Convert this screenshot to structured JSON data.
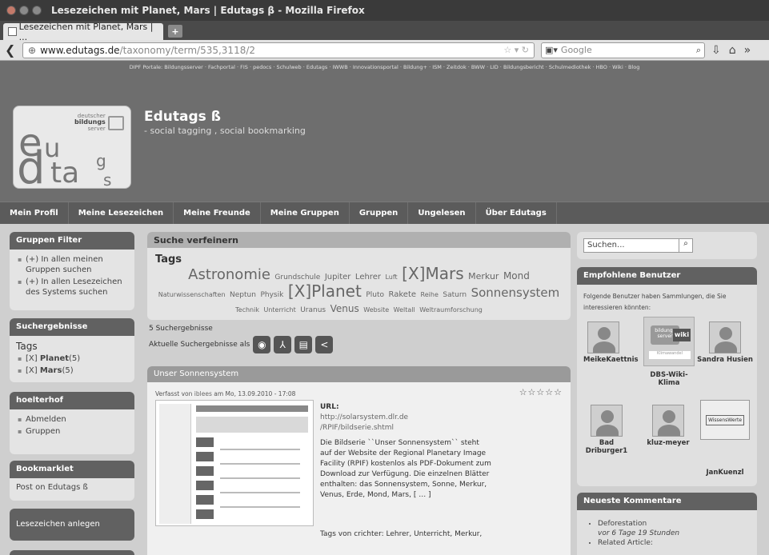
{
  "window": {
    "title": "Lesezeichen mit Planet, Mars | Edutags β - Mozilla Firefox"
  },
  "tab": {
    "label": "Lesezeichen mit Planet, Mars | ...",
    "new_tab": "+"
  },
  "nav": {
    "url_domain": "www.edutags.de",
    "url_path": "/taxonomy/term/535,3118/2",
    "search_placeholder": "Google"
  },
  "portal_links": "DIPF Portale: Bildungsserver · Fachportal · FIS · pedocs · Schulweb · Edutags · IWWB · Innovationsportal · Bildung+ · ISM · Zeitdok · BWW · LID · Bildungsbericht · Schulmediothek · HBO · Wiki · Blog",
  "logo": {
    "small1": "deutscher",
    "small2": "bildungs",
    "small3": "server",
    "e": "e",
    "u": "u",
    "d": "d",
    "ta": "ta",
    "g": "g",
    "s": "s"
  },
  "site": {
    "title": "Edutags ß",
    "subtitle": "- social tagging , social bookmarking"
  },
  "menu": [
    "Mein Profil",
    "Meine Lesezeichen",
    "Meine Freunde",
    "Meine Gruppen",
    "Gruppen",
    "Ungelesen",
    "Über Edutags"
  ],
  "left": {
    "gruppen_filter": {
      "title": "Gruppen Filter",
      "items": [
        "(+) In allen meinen Gruppen suchen",
        "(+) In allen Lesezeichen des Systems suchen"
      ]
    },
    "suchergebnisse": {
      "title": "Suchergebnisse",
      "tags_label": "Tags",
      "items": [
        {
          "prefix": "[X]",
          "tag": "Planet",
          "count": "(5)"
        },
        {
          "prefix": "[X]",
          "tag": "Mars",
          "count": "(5)"
        }
      ]
    },
    "user": {
      "title": "hoelterhof",
      "items": [
        "Abmelden",
        "Gruppen"
      ]
    },
    "bookmarklet": {
      "title": "Bookmarklet",
      "body": "Post on Edutags ß"
    },
    "lesezeichen": {
      "body": "Lesezeichen anlegen"
    }
  },
  "middle": {
    "refine_title": "Suche verfeinern",
    "tags_title": "Tags",
    "tags": [
      {
        "t": "Astronomie",
        "s": "18px"
      },
      {
        "t": "Grundschule",
        "s": "9px"
      },
      {
        "t": "Jupiter",
        "s": "10px"
      },
      {
        "t": "Lehrer",
        "s": "10px"
      },
      {
        "t": "Luft",
        "s": "8px"
      },
      {
        "t": "[X]Mars",
        "s": "20px"
      },
      {
        "t": "Merkur",
        "s": "11px"
      },
      {
        "t": "Mond",
        "s": "12px"
      },
      {
        "t": "Naturwissenschaften",
        "s": "8px"
      },
      {
        "t": "Neptun",
        "s": "9px"
      },
      {
        "t": "Physik",
        "s": "9px"
      },
      {
        "t": "[X]Planet",
        "s": "20px"
      },
      {
        "t": "Pluto",
        "s": "9px"
      },
      {
        "t": "Rakete",
        "s": "10px"
      },
      {
        "t": "Reihe",
        "s": "8px"
      },
      {
        "t": "Saturn",
        "s": "9px"
      },
      {
        "t": "Sonnensystem",
        "s": "15px"
      },
      {
        "t": "Technik",
        "s": "8px"
      },
      {
        "t": "Unterricht",
        "s": "8px"
      },
      {
        "t": "Uranus",
        "s": "9px"
      },
      {
        "t": "Venus",
        "s": "12px"
      },
      {
        "t": "Website",
        "s": "8px"
      },
      {
        "t": "Weltall",
        "s": "8px"
      },
      {
        "t": "Weltraumforschung",
        "s": "8px"
      }
    ],
    "result_count": "5 Suchergebnisse",
    "export_label": "Aktuelle Suchergebnisse als",
    "article": {
      "title": "Unser Sonnensystem",
      "meta_prefix": "Verfasst von",
      "meta_author": "iblees",
      "meta_date": "am Mo, 13.09.2010 - 17:08",
      "stars": "☆☆☆☆☆",
      "url_label": "URL:",
      "url1": "http://solarsystem.dlr.de",
      "url2": "/RPIF/bildserie.shtml",
      "desc": "Die Bildserie ``Unser Sonnensystem`` steht auf der Website der Regional Planetary Image Facility (RPIF) kostenlos als PDF-Dokument zum Download zur Verfügung. Die einzelnen Blätter enthalten: das Sonnensystem, Sonne, Merkur, Venus, Erde, Mond, Mars, [ … ]",
      "tags_prefix": "Tags von",
      "tags_author": "crichter",
      "tags_list": ": Lehrer, Unterricht, Merkur,"
    }
  },
  "right": {
    "search_placeholder": "Suchen...",
    "empf_title": "Empfohlene Benutzer",
    "empf_intro": "Folgende Benutzer haben Sammlungen, die Sie interessieren könnten:",
    "users": [
      "MeikeKaettnis",
      "DBS-Wiki-Klima",
      "Sandra Husien",
      "Bad Driburger1",
      "kluz-meyer",
      "JanKuenzl"
    ],
    "wiki_badge": "wiki",
    "wiki_small": "Klimawandel",
    "wissen_badge": "WissensWerte",
    "comments_title": "Neueste Kommentare",
    "comments": [
      "Deforestation",
      "vor 6 Tage 19 Stunden",
      "Related Article:"
    ]
  }
}
